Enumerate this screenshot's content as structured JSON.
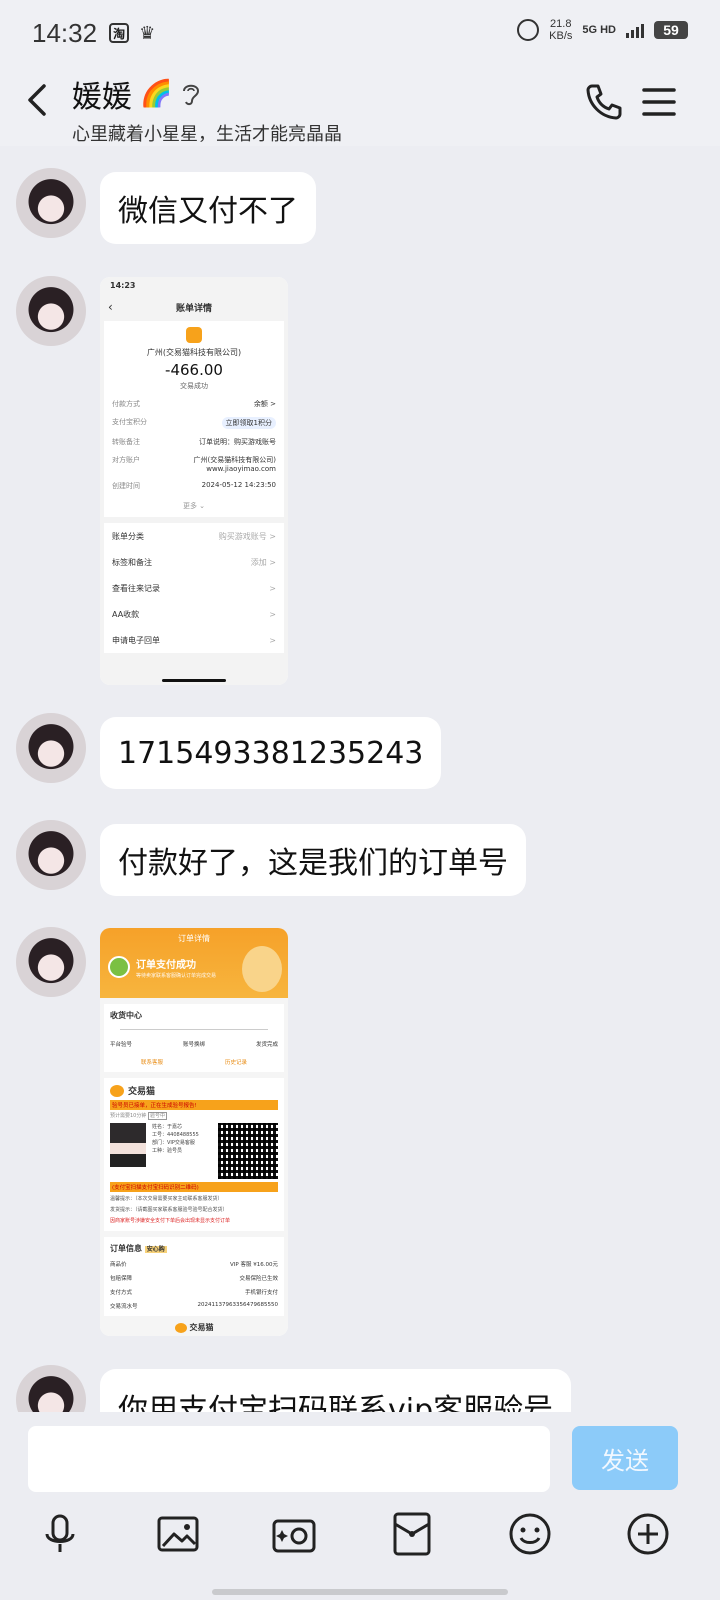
{
  "status_bar": {
    "time": "14:32",
    "app_icon": "淘",
    "net_speed_value": "21.8",
    "net_speed_unit": "KB/s",
    "network": "5G HD",
    "battery": "59"
  },
  "header": {
    "title": "媛媛",
    "title_emoji": "🌈",
    "subtitle": "心里藏着小星星，生活才能亮晶晶"
  },
  "messages": [
    {
      "type": "text",
      "text": "微信又付不了"
    },
    {
      "type": "image",
      "kind": "payment-receipt"
    },
    {
      "type": "text",
      "text": "1715493381235243"
    },
    {
      "type": "text",
      "text": "付款好了，这是我们的订单号"
    },
    {
      "type": "image",
      "kind": "order-detail"
    },
    {
      "type": "text",
      "text": "你用支付宝扫码联系vip客服验号"
    }
  ],
  "receipt": {
    "status_time": "14:23",
    "header": "账单详情",
    "logo_label": "交易猫",
    "company": "广州(交易猫科技有限公司)",
    "amount": "-466.00",
    "state": "交易成功",
    "rows": [
      {
        "k": "付款方式",
        "v": "余额 >"
      },
      {
        "k": "支付宝积分",
        "v": "立即领取1积分"
      },
      {
        "k": "转账备注",
        "v": "订单说明：购买游戏账号"
      },
      {
        "k": "对方账户",
        "v": "广州(交易猫科技有限公司) www.jiaoyimao.com"
      },
      {
        "k": "创建时间",
        "v": "2024-05-12 14:23:50"
      }
    ],
    "more": "更多 ⌄",
    "list": [
      {
        "label": "账单分类",
        "right": "购买游戏账号 >"
      },
      {
        "label": "标签和备注",
        "right": "添加 >"
      },
      {
        "label": "查看往来记录",
        "right": ">"
      },
      {
        "label": "AA收款",
        "right": ">"
      },
      {
        "label": "申请电子回单",
        "right": ">"
      }
    ]
  },
  "order": {
    "title": "订单详情",
    "success": "订单支付成功",
    "success_sub": "等待卖家联系客服确认订单完成交易",
    "section": "收货中心",
    "steps": [
      "平台验号",
      "账号换绑",
      "发货完成"
    ],
    "btn_left": "联系客服",
    "btn_right": "历史记录",
    "brand": "交易猫",
    "warn": "验号员已接单，正在生成验号报告!",
    "eta": "预计需要10分钟",
    "eta_tag": "验号中",
    "staff": [
      "姓名：于嘉芯",
      "工号：4408488555",
      "部门：VIP交易客服",
      "工种：验号员"
    ],
    "scan_tip": "(支付宝扫描支付宝扫码识别二维码)",
    "notes": [
      "温馨提示：（本次交易需要买家主动联系客服发货）",
      "发货提示：（请截图买家联系客服验号验号配合发货）"
    ],
    "red_note": "因商家账号涉嫌安全支付下单后会出现未显示支付订单",
    "info_title": "订单信息",
    "info_tag": "安心购",
    "info_rows": [
      {
        "k": "商品价",
        "v": "VIP 客服 ¥16.00元"
      },
      {
        "k": "包赔保障",
        "v": "交易保险已生效"
      },
      {
        "k": "支付方式",
        "v": "手机银行支付"
      },
      {
        "k": "交易流水号",
        "v": "20241137963356479685550"
      }
    ],
    "footer_brand": "交易猫"
  },
  "input": {
    "send_label": "发送",
    "placeholder": ""
  },
  "colors": {
    "background": "#ecedf2",
    "send_button": "#8ccbf9",
    "bubble": "#ffffff"
  }
}
